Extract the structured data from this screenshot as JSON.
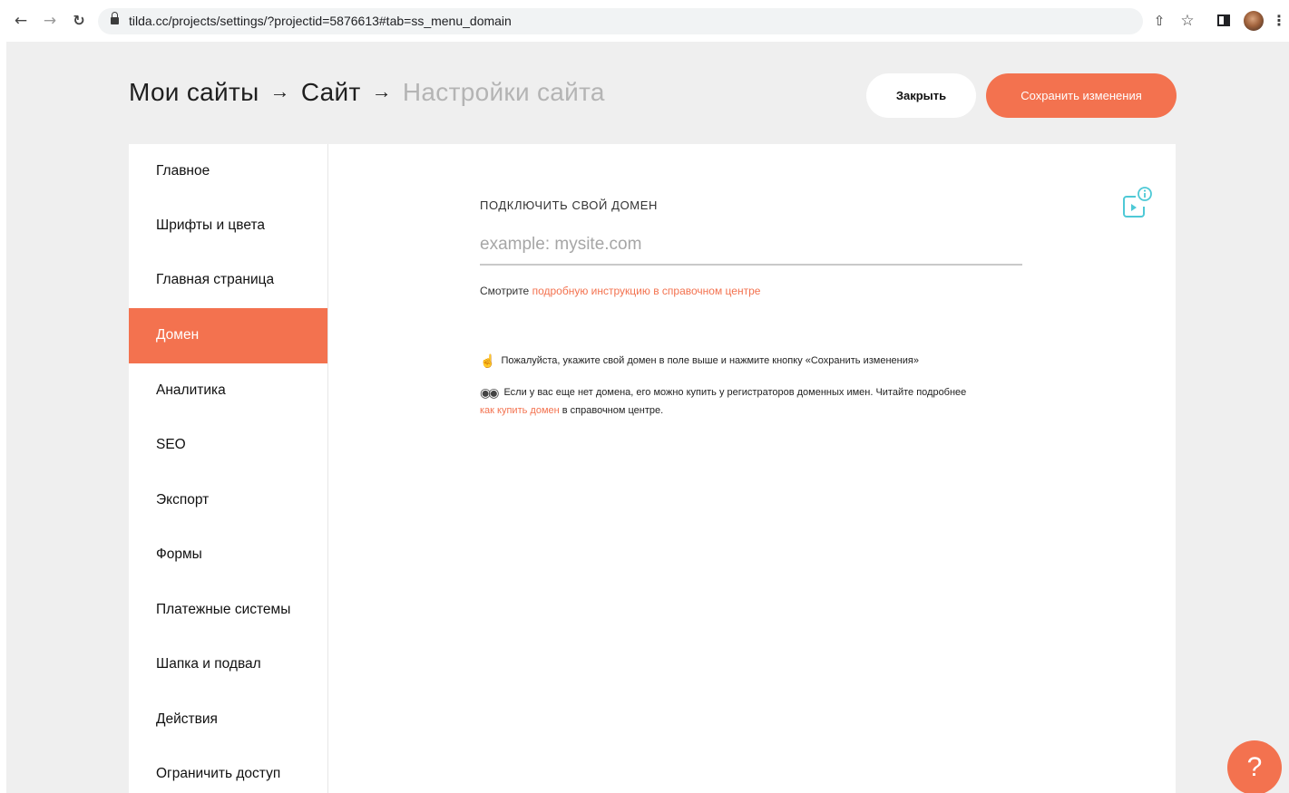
{
  "browser": {
    "url": "tilda.cc/projects/settings/?projectid=5876613#tab=ss_menu_domain",
    "icons": {
      "back": "arrow-left-icon",
      "forward": "arrow-right-icon",
      "reload": "reload-icon",
      "lock": "lock-icon",
      "share": "share-icon",
      "bookmark": "star-icon",
      "side_panel": "side-panel-icon",
      "menu": "menu-dots-icon"
    }
  },
  "header": {
    "breadcrumb": {
      "item1": "Мои сайты",
      "item2": "Сайт",
      "current": "Настройки сайта",
      "separator": "→"
    },
    "close_label": "Закрыть",
    "save_label": "Сохранить изменения"
  },
  "sidebar": {
    "items": [
      {
        "label": "Главное",
        "active": false
      },
      {
        "label": "Шрифты и цвета",
        "active": false
      },
      {
        "label": "Главная страница",
        "active": false
      },
      {
        "label": "Домен",
        "active": true
      },
      {
        "label": "Аналитика",
        "active": false
      },
      {
        "label": "SEO",
        "active": false
      },
      {
        "label": "Экспорт",
        "active": false
      },
      {
        "label": "Формы",
        "active": false
      },
      {
        "label": "Платежные системы",
        "active": false
      },
      {
        "label": "Шапка и подвал",
        "active": false
      },
      {
        "label": "Действия",
        "active": false
      },
      {
        "label": "Ограничить доступ",
        "active": false
      }
    ]
  },
  "domain": {
    "section_title": "ПОДКЛЮЧИТЬ СВОЙ ДОМЕН",
    "input_value": "",
    "input_placeholder": "example: mysite.com",
    "hint_prefix": "Смотрите",
    "hint_link": "подробную инструкцию в справочном центре",
    "note1": "Пожалуйста, укажите свой домен в поле выше и нажмите кнопку «Сохранить изменения»",
    "note2_text": "Если у вас еще нет домена, его можно купить у регистраторов доменных имен. Читайте подробнее",
    "note2_link": "как купить домен",
    "note2_suffix": "в справочном центре."
  },
  "help": {
    "label": "?"
  },
  "colors": {
    "accent": "#f3724f",
    "page_background": "#efefef",
    "panel_background": "#ffffff",
    "muted_text": "#b4b4b4",
    "info_icon": "#4ec9d6"
  }
}
